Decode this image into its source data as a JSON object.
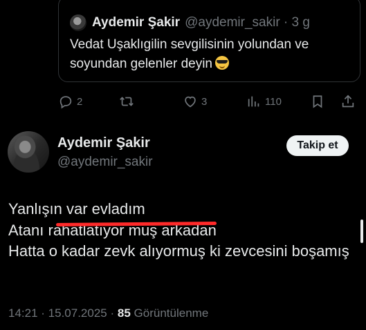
{
  "quoted_tweet": {
    "author_name": "Aydemir Şakir",
    "handle": "@aydemir_sakir",
    "separator": "·",
    "age": "3 g",
    "text": "Vedat Uşaklıgilin sevgilisinin yolundan ve soyundan gelenler deyin",
    "emoji": "smiling-face-with-sunglasses"
  },
  "actions": {
    "reply_count": "2",
    "retweet_count": "",
    "like_count": "3",
    "views_count": "110"
  },
  "tweet": {
    "author_name": "Aydemir Şakir",
    "handle": "@aydemir_sakir",
    "follow_label": "Takip et",
    "line1": "Yanlışın var evladım",
    "line2_prefix": "Atanı r",
    "line2_redacted": "ahatlatıyor muş arkadan",
    "line3": "Hatta o kadar zevk alıyormuş ki zevcesini boşamış",
    "time": "14:21",
    "date": "15.07.2025",
    "dot": "·",
    "views": "85",
    "views_label": "Görüntülenme"
  },
  "colors": {
    "background": "#000000",
    "text": "#e7e9ea",
    "muted": "#71767b",
    "border": "#2f3336",
    "redaction": "#ff2a2a",
    "button_bg": "#eff3f4"
  }
}
